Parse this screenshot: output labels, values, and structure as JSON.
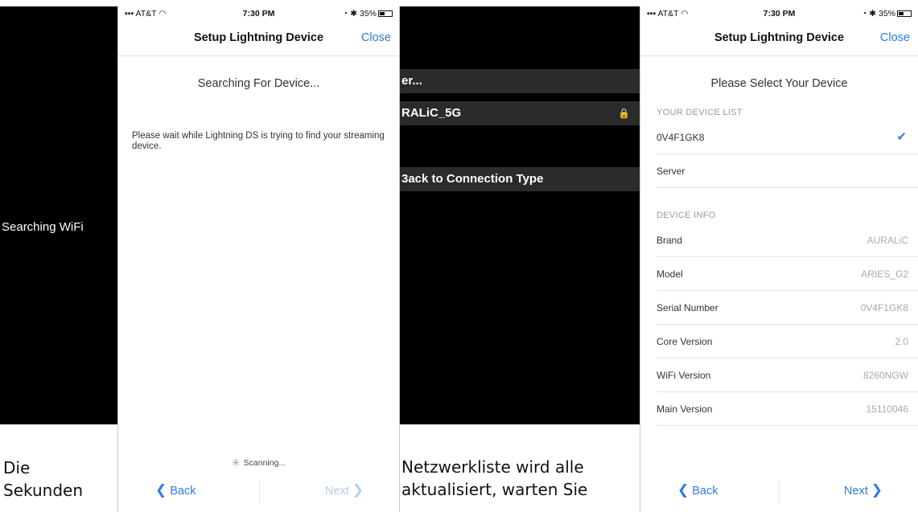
{
  "left_panel": {
    "message": "Searching WiFi"
  },
  "status_bar": {
    "carrier": "AT&T",
    "time": "7:30 PM",
    "battery": "35%"
  },
  "screen1": {
    "title": "Setup Lightning Device",
    "close_label": "Close",
    "heading": "Searching For Device...",
    "body": "Please wait while Lightning DS is trying to find your streaming device.",
    "scanning": "Scanning...",
    "back_label": "Back",
    "next_label": "Next"
  },
  "middle_panel": {
    "row1": "er...",
    "row2": "RALiC_5G",
    "row3": "3ack to Connection Type",
    "lock_icon": "lock-icon"
  },
  "captions": {
    "left_line1": "Die",
    "left_line2": "Sekunden",
    "mid_line1": "Netzwerkliste wird alle",
    "mid_line2": "aktualisiert, warten Sie"
  },
  "screen2": {
    "title": "Setup Lightning Device",
    "close_label": "Close",
    "heading": "Please Select Your Device",
    "device_list_label": "YOUR DEVICE LIST",
    "devices": [
      {
        "name": "0V4F1GK8",
        "selected": true
      },
      {
        "name": "Server",
        "selected": false
      }
    ],
    "device_info_label": "DEVICE INFO",
    "info": [
      {
        "label": "Brand",
        "value": "AURALiC"
      },
      {
        "label": "Model",
        "value": "ARIES_G2"
      },
      {
        "label": "Serial Number",
        "value": "0V4F1GK8"
      },
      {
        "label": "Core Version",
        "value": "2.0"
      },
      {
        "label": "WiFi Version",
        "value": "8260NGW"
      },
      {
        "label": "Main Version",
        "value": "15110046"
      }
    ],
    "back_label": "Back",
    "next_label": "Next"
  },
  "colors": {
    "accent": "#2f7be5",
    "disabled": "#b8cdec",
    "dark": "#000000"
  }
}
